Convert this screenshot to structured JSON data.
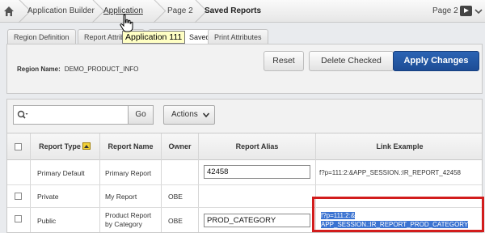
{
  "breadcrumb": {
    "items": [
      "Application Builder",
      "Application 111",
      "Page 2",
      "Saved Reports"
    ],
    "page_label": "Page 2"
  },
  "tabs": [
    "Region Definition",
    "Report Attributes",
    "Saved Reports",
    "Print Attributes"
  ],
  "tooltip": "Application 111",
  "panel": {
    "region_label": "Region Name:",
    "region_value": "DEMO_PRODUCT_INFO",
    "buttons": {
      "reset": "Reset",
      "delete_checked": "Delete Checked",
      "apply": "Apply Changes"
    }
  },
  "toolbar": {
    "search_value": "",
    "go": "Go",
    "actions": "Actions"
  },
  "table": {
    "headers": [
      "Report Type",
      "Report Name",
      "Owner",
      "Report Alias",
      "Link Example"
    ],
    "rows": [
      {
        "type": "Primary Default",
        "name": "Primary Report",
        "owner": "",
        "alias": "42458",
        "link": "f?p=111:2:&APP_SESSION.:IR_REPORT_42458"
      },
      {
        "type": "Private",
        "name": "My Report",
        "owner": "OBE",
        "alias": "",
        "link": ""
      },
      {
        "type": "Public",
        "name_line1": "Product Report",
        "name_line2": "by Category",
        "owner": "OBE",
        "alias": "PROD_CATEGORY",
        "link_line1": "f?p=111:2:&",
        "link_line2": "APP_SESSION.:IR_REPORT_PROD_CATEGORY"
      }
    ]
  },
  "colors": {
    "primary_button": "#1d4c95",
    "highlight": "#3b73d1",
    "callout_border": "#d21c1c",
    "tooltip_bg": "#ffffc4"
  },
  "icons": [
    "home-icon",
    "search-icon",
    "run-icon",
    "chevron-down-icon",
    "sort-icon",
    "pointer-cursor-icon"
  ]
}
